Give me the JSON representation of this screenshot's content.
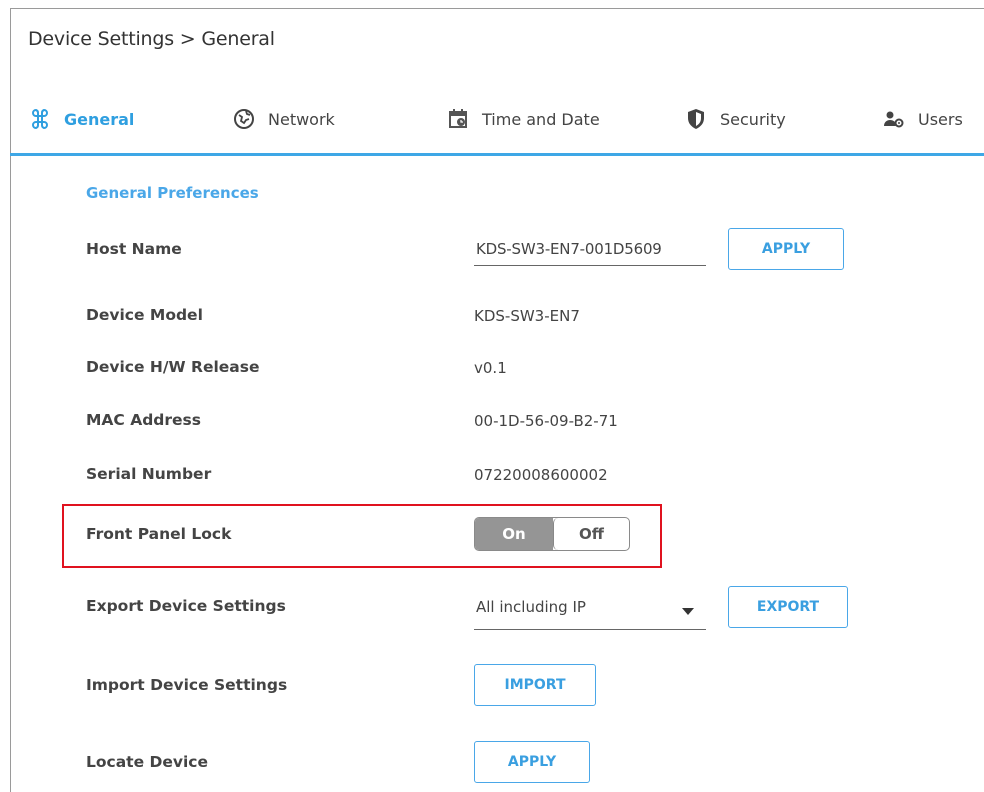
{
  "breadcrumb": "Device Settings > General",
  "tabs": [
    {
      "label": "General",
      "icon": "general-icon",
      "active": true
    },
    {
      "label": "Network",
      "icon": "network-icon"
    },
    {
      "label": "Time and Date",
      "icon": "calendar-icon"
    },
    {
      "label": "Security",
      "icon": "shield-icon"
    },
    {
      "label": "Users",
      "icon": "users-icon"
    }
  ],
  "colors": {
    "accent": "#3ea7e6",
    "highlight": "#e0121f",
    "toggle_on": "#959595"
  },
  "section_title": "General Preferences",
  "fields": {
    "host_name": {
      "label": "Host Name",
      "value": "KDS-SW3-EN7-001D5609",
      "button": "APPLY"
    },
    "device_model": {
      "label": "Device Model",
      "value": "KDS-SW3-EN7"
    },
    "hw_release": {
      "label": "Device H/W Release",
      "value": "v0.1"
    },
    "mac": {
      "label": "MAC Address",
      "value": "00-1D-56-09-B2-71"
    },
    "serial": {
      "label": "Serial Number",
      "value": "07220008600002"
    },
    "front_panel_lock": {
      "label": "Front Panel Lock",
      "on_label": "On",
      "off_label": "Off",
      "selected": "Off"
    },
    "export": {
      "label": "Export Device Settings",
      "selected": "All including IP",
      "button": "EXPORT"
    },
    "import": {
      "label": "Import Device Settings",
      "button": "IMPORT"
    },
    "locate": {
      "label": "Locate Device",
      "button": "APPLY"
    }
  }
}
